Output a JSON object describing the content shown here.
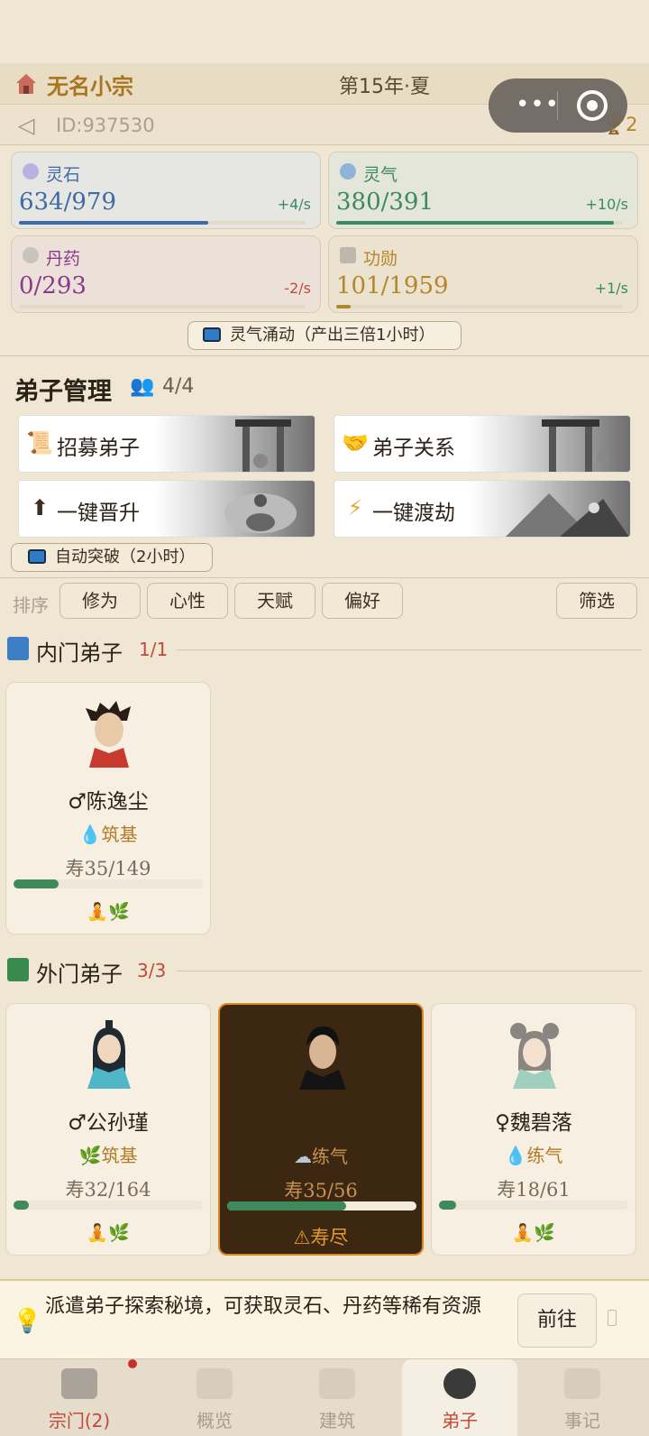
{
  "header": {
    "sect_name": "无名小宗",
    "season": "第15年·夏",
    "id_text": "ID:937530",
    "trophy_count": "2"
  },
  "resources": [
    {
      "label": "灵石",
      "value": "634/979",
      "rate": "+4/s",
      "fill": 0.66,
      "color": "#3f6aa7",
      "bg": "#e6e7e2"
    },
    {
      "label": "灵气",
      "value": "380/391",
      "rate": "+10/s",
      "fill": 0.97,
      "color": "#3a8a63",
      "bg": "#e5e6da"
    },
    {
      "label": "丹药",
      "value": "0/293",
      "rate": "-2/s",
      "fill": 0.0,
      "color": "#8a3a8a",
      "bg": "#ece1d9"
    },
    {
      "label": "功勋",
      "value": "101/1959",
      "rate": "+1/s",
      "fill": 0.05,
      "color": "#b5862a",
      "bg": "#ebe2cf"
    }
  ],
  "boost_button": "灵气涌动（产出三倍1小时）",
  "management": {
    "title": "弟子管理",
    "count": "4/4",
    "actions": [
      {
        "label": "招募弟子",
        "icon": "scroll-icon"
      },
      {
        "label": "弟子关系",
        "icon": "handshake-icon"
      },
      {
        "label": "一键晋升",
        "icon": "arrow-up-icon"
      },
      {
        "label": "一键渡劫",
        "icon": "lightning-icon"
      }
    ],
    "auto_button": "自动突破（2小时）"
  },
  "sort": {
    "label": "排序",
    "options": [
      "修为",
      "心性",
      "天赋",
      "偏好"
    ],
    "filter": "筛选"
  },
  "inner": {
    "title": "内门弟子",
    "count": "1/1",
    "disciples": [
      {
        "name": "♂陈逸尘",
        "realm": "筑基",
        "realm_icon": "water-drop-icon",
        "life": "寿35/149",
        "fill": 0.24,
        "status": "🧘🌿"
      }
    ]
  },
  "outer": {
    "title": "外门弟子",
    "count": "3/3",
    "disciples": [
      {
        "name": "♂公孙瑾",
        "realm": "筑基",
        "realm_icon": "herb-icon",
        "life": "寿32/164",
        "fill": 0.08,
        "status": "🧘🌿"
      },
      {
        "name": "",
        "realm": "练气",
        "realm_icon": "cloud-icon",
        "life": "寿35/56",
        "fill": 0.63,
        "status": "⚠寿尽"
      },
      {
        "name": "♀魏碧落",
        "realm": "练气",
        "realm_icon": "water-drop-icon",
        "life": "寿18/61",
        "fill": 0.09,
        "status": "🧘🌿"
      }
    ]
  },
  "tip": {
    "text": "派遣弟子探索秘境，可获取灵石、丹药等稀有资源",
    "go": "前往"
  },
  "tabs": [
    "宗门(2)",
    "概览",
    "建筑",
    "弟子",
    "事记"
  ],
  "colors": {
    "accent": "#a7761f",
    "active_tab": "#c24a3a",
    "progress_green": "#3e8a5a",
    "warn_orange": "#e89a2a"
  }
}
